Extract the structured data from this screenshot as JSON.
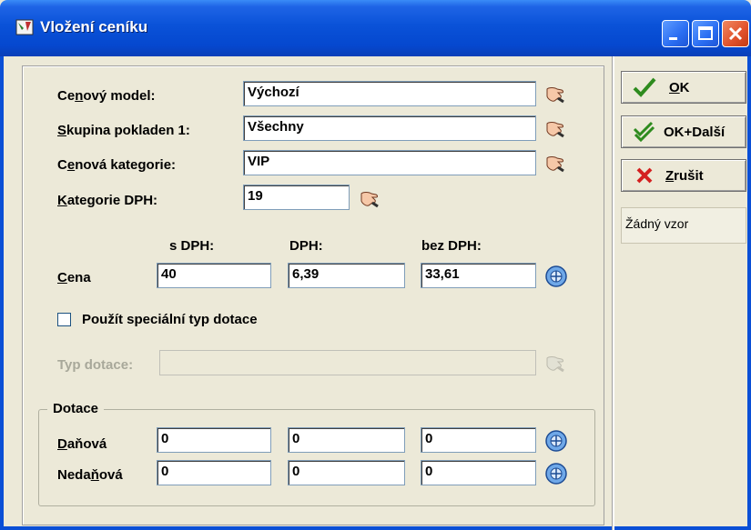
{
  "window": {
    "title": "Vložení ceníku"
  },
  "form": {
    "cenovy_model": {
      "label_pre": "Ce",
      "label_ul": "n",
      "label_post": "ový model:",
      "value": "Výchozí"
    },
    "skupina": {
      "label_pre": "",
      "label_ul": "S",
      "label_post": "kupina pokladen 1:",
      "value": "Všechny"
    },
    "kategorie": {
      "label_pre": "C",
      "label_ul": "e",
      "label_post": "nová kategorie:",
      "value": "VIP"
    },
    "dph_kat": {
      "label_pre": "",
      "label_ul": "K",
      "label_post": "ategorie DPH:",
      "value": "19"
    }
  },
  "price": {
    "col_s_dph": "s DPH:",
    "col_dph": "DPH:",
    "col_bez_dph": "bez DPH:",
    "label_ul": "C",
    "label_post": "ena",
    "s_dph": "40",
    "dph": "6,39",
    "bez_dph": "33,61"
  },
  "special": {
    "checkbox_label": "Použít speciální typ dotace",
    "checked": false,
    "typ_label": "Typ dotace:",
    "typ_value": ""
  },
  "dotace": {
    "title": "Dotace",
    "danova": {
      "label_pre": "",
      "label_ul": "D",
      "label_post": "aňová",
      "v1": "0",
      "v2": "0",
      "v3": "0"
    },
    "nedanova": {
      "label_pre": "Neda",
      "label_ul": "ň",
      "label_post": "ová",
      "v1": "0",
      "v2": "0",
      "v3": "0"
    }
  },
  "actions": {
    "ok": {
      "label_ul": "O",
      "label_post": "K"
    },
    "ok_next": {
      "label": "OK+Další"
    },
    "cancel": {
      "label_ul": "Z",
      "label_post": "rušit"
    },
    "template": "Žádný vzor"
  },
  "colors": {
    "title_bar": "#0a52d8",
    "face": "#ece9d8",
    "close": "#e0502a",
    "ok_check": "#2e8b1e",
    "cancel_x": "#d42020"
  },
  "icons": [
    "app-icon",
    "hand-pointer-icon",
    "calculator-icon",
    "checkmark-icon",
    "double-checkmark-icon",
    "cross-icon"
  ]
}
